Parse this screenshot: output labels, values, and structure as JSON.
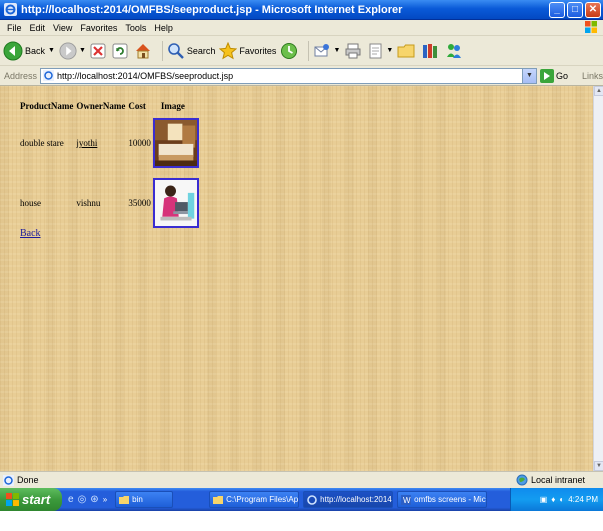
{
  "window": {
    "title": "http://localhost:2014/OMFBS/seeproduct.jsp - Microsoft Internet Explorer"
  },
  "menu": [
    "File",
    "Edit",
    "View",
    "Favorites",
    "Tools",
    "Help"
  ],
  "toolbar": {
    "back_label": "Back",
    "search_label": "Search",
    "favorites_label": "Favorites"
  },
  "address": {
    "label": "Address",
    "url": "http://localhost:2014/OMFBS/seeproduct.jsp",
    "go_label": "Go",
    "links_label": "Links"
  },
  "table": {
    "headers": [
      "ProductName",
      "OwnerName",
      "Cost",
      "Image"
    ],
    "rows": [
      {
        "product": "double stare",
        "owner": "jyothi",
        "cost": "10000",
        "image": "bedroom-photo"
      },
      {
        "product": "house",
        "owner": "vishnu",
        "cost": "35000",
        "image": "woman-laptop-photo"
      }
    ]
  },
  "back_link": "Back",
  "status": {
    "text": "Done",
    "zone": "Local intranet"
  },
  "taskbar": {
    "start_label": "start",
    "tasks": [
      {
        "label": "bin"
      },
      {
        "label": "C:\\Program Files\\Apa..."
      },
      {
        "label": "http://localhost:2014..."
      },
      {
        "label": "omfbs screens - Micro..."
      }
    ],
    "clock": "4:24 PM"
  },
  "colors": {
    "content_bg": "#e8cd95",
    "link": "#1b1b9c",
    "image_border": "#3a2dd1"
  }
}
